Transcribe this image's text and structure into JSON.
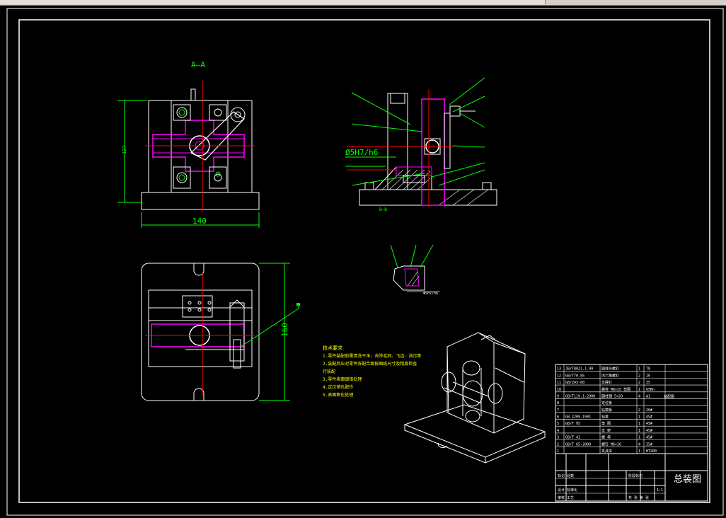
{
  "drawing": {
    "section_label": "A—A",
    "front_dims": {
      "width": "140",
      "height": "127"
    },
    "plan_dims": {
      "height": "160"
    },
    "fit_label": "Ø5H7/h6",
    "small_dim": "Φ5H7/h6",
    "ab_label": "B—B",
    "title": "总装图",
    "tech_requirements": {
      "title": "技术要求",
      "lines": [
        "1.零件装配前需清洗干净，去除毛刺、飞边、油污等",
        "2.装配后应对零件各配合面按图纸尺寸及精度检查",
        "行装配",
        "3.零件表面镀铬处理",
        "4.定位销孔配作",
        "5.表面氧化处理"
      ]
    },
    "bom_rows": [
      {
        "no": "13",
        "code": "JB/T8021.1-99",
        "name": "圆柱头螺钉",
        "qty": "1",
        "mat": "T8"
      },
      {
        "no": "12",
        "code": "GB/T70-85",
        "name": "内六角螺钉",
        "qty": "2",
        "mat": "20"
      },
      {
        "no": "11",
        "code": "GB/Z43-80",
        "name": "支撑钉",
        "qty": "2",
        "mat": "35"
      },
      {
        "no": "10",
        "code": "",
        "name": "螺栓 M8×25 垫圈",
        "qty": "1",
        "mat": "65Mn"
      },
      {
        "no": "9",
        "code": "GB/T119.1-2000",
        "name": "圆柱销 5×20",
        "qty": "4",
        "mat": "A1"
      },
      {
        "no": "8",
        "code": "",
        "name": "定位板",
        "qty": "",
        "mat": ""
      },
      {
        "no": "7",
        "code": "",
        "name": "钻模板",
        "qty": "2",
        "mat": "20#"
      },
      {
        "no": "6",
        "code": "GB 2209-1991",
        "name": "钻套",
        "qty": "1",
        "mat": "45#"
      },
      {
        "no": "5",
        "code": "GB/T 95",
        "name": "垫 圈",
        "qty": "1",
        "mat": "45#"
      },
      {
        "no": "4",
        "code": "",
        "name": "支 架",
        "qty": "1",
        "mat": "45#"
      },
      {
        "no": "3",
        "code": "GB/T 41",
        "name": "螺 母",
        "qty": "1",
        "mat": "45#"
      },
      {
        "no": "2",
        "code": "GB/T 65-2000",
        "name": "螺钉 M6×20",
        "qty": "4",
        "mat": "35#"
      },
      {
        "no": "1",
        "code": "",
        "name": "夹具体",
        "qty": "1",
        "mat": "HT200"
      }
    ],
    "title_block": {
      "small1": "标记 处数",
      "small2": "设计 标准化",
      "small3": "审核 工艺",
      "scale": "1:1",
      "stage": "阶段标记",
      "weight": "重量 比例",
      "sheet": "共 张 第 张"
    }
  },
  "colors": {
    "background": "#000000",
    "border": "#ffffff",
    "outline": "#ffffff",
    "part_magenta": "#ff00ff",
    "dimension_green": "#00ff00",
    "centerline_red": "#ff0000",
    "yellow_text": "#ffff00",
    "cyan": "#00ffff"
  }
}
